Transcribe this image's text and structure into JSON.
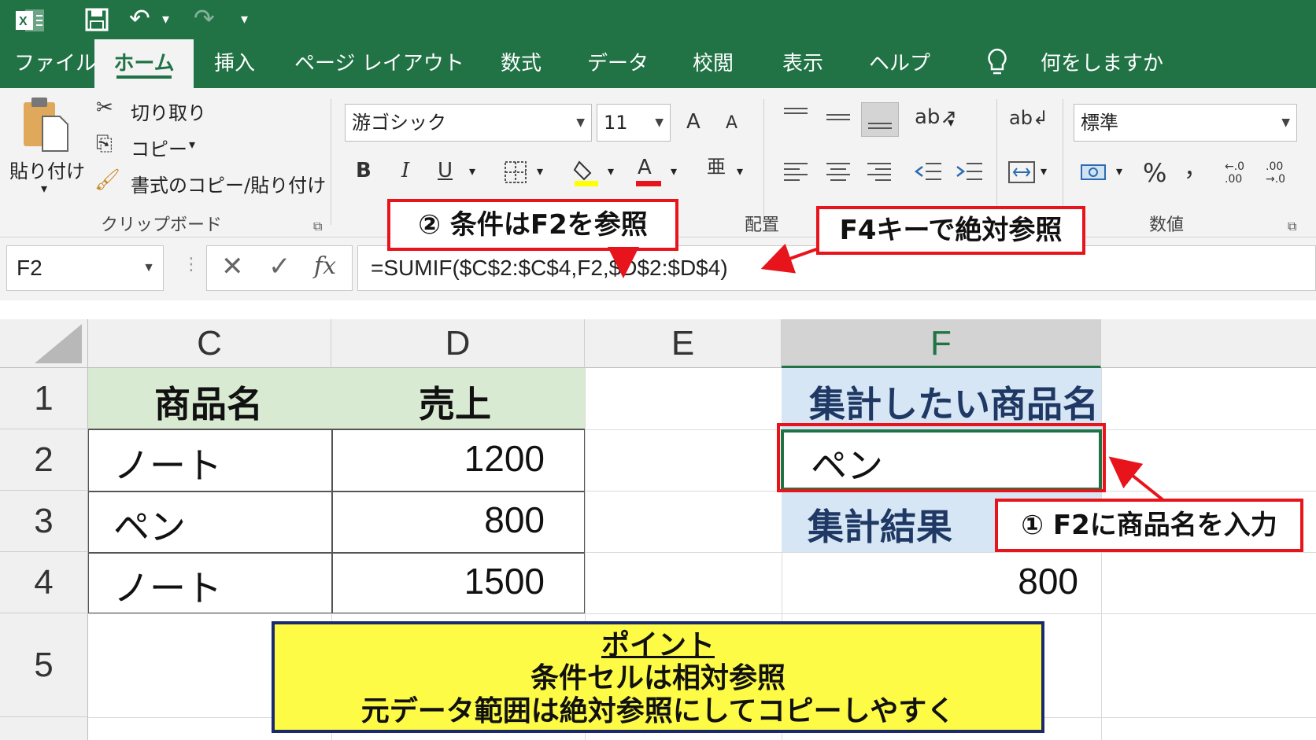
{
  "quick_access": {
    "undo": "↶",
    "redo": "↷",
    "save": "💾",
    "customize": "▾"
  },
  "tabs": [
    "ファイル",
    "ホーム",
    "挿入",
    "ページ レイアウト",
    "数式",
    "データ",
    "校閲",
    "表示",
    "ヘルプ"
  ],
  "tell_me": "何をしますか",
  "clipboard": {
    "paste": "貼り付け",
    "cut": "切り取り",
    "copy": "コピー",
    "format_painter": "書式のコピー/貼り付け",
    "group_label": "クリップボード"
  },
  "font": {
    "name": "游ゴシック",
    "size": "11",
    "grow": "A",
    "shrink": "A",
    "bold": "B",
    "italic": "I",
    "underline": "U",
    "font_color": "A"
  },
  "alignment": {
    "group_label": "配置"
  },
  "number": {
    "format": "標準",
    "percent": "%",
    "comma": "，",
    "group_label": "数値",
    "inc_decimal": ".00",
    "dec_decimal": ".00"
  },
  "formula_bar": {
    "name_box": "F2",
    "formula": "=SUMIF($C$2:$C$4,F2,$D$2:$D$4)",
    "cancel": "✕",
    "enter": "✓",
    "fx": "fx"
  },
  "columns": [
    "C",
    "D",
    "E",
    "F"
  ],
  "rows": [
    "1",
    "2",
    "3",
    "4",
    "5"
  ],
  "cells": {
    "C1": "商品名",
    "D1": "売上",
    "C2": "ノート",
    "D2": "1200",
    "C3": "ペン",
    "D3": "800",
    "C4": "ノート",
    "D4": "1500",
    "F1": "集計したい商品名",
    "F2": "ペン",
    "F3": "集計結果",
    "F4": "800"
  },
  "callouts": {
    "condition": "② 条件はF2を参照",
    "f4": "F4キーで絶対参照",
    "input": "① F2に商品名を入力"
  },
  "point": {
    "title": "ポイント",
    "line1": "条件セルは相対参照",
    "line2": "元データ範囲は絶対参照にしてコピーしやすく"
  },
  "colors": {
    "excel_green": "#217346",
    "header_green": "#d9ead3",
    "header_blue": "#d6e6f5",
    "callout_red": "#e8141b",
    "point_yellow": "#fdfb46"
  }
}
